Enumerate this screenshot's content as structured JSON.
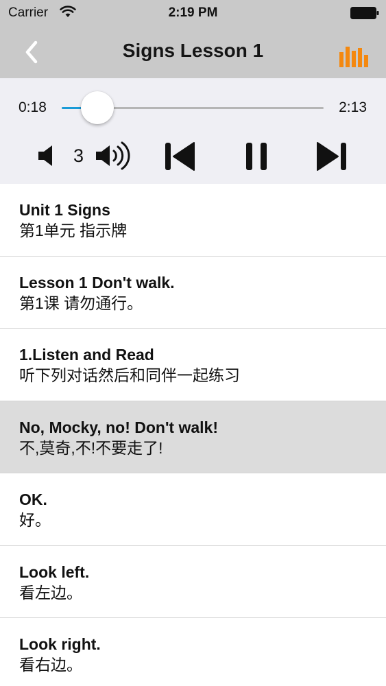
{
  "status_bar": {
    "carrier": "Carrier",
    "time": "2:19 PM"
  },
  "nav": {
    "title": "Signs Lesson 1",
    "accent_color": "#f4880f"
  },
  "player": {
    "current_time": "0:18",
    "total_time": "2:13",
    "progress_fraction": 0.135,
    "volume_level": "3",
    "track_color": "#1a9bd7"
  },
  "lessons": [
    {
      "en": "Unit 1 Signs",
      "zh": "第1单元 指示牌",
      "active": false
    },
    {
      "en": "Lesson 1 Don't walk.",
      "zh": "第1课 请勿通行。",
      "active": false
    },
    {
      "en": "1.Listen and Read",
      "zh": "听下列对话然后和同伴一起练习",
      "active": false
    },
    {
      "en": "No, Mocky, no! Don't walk!",
      "zh": "不,莫奇,不!不要走了!",
      "active": true
    },
    {
      "en": "OK.",
      "zh": "好。",
      "active": false
    },
    {
      "en": "Look left.",
      "zh": "看左边。",
      "active": false
    },
    {
      "en": "Look right.",
      "zh": "看右边。",
      "active": false
    }
  ]
}
